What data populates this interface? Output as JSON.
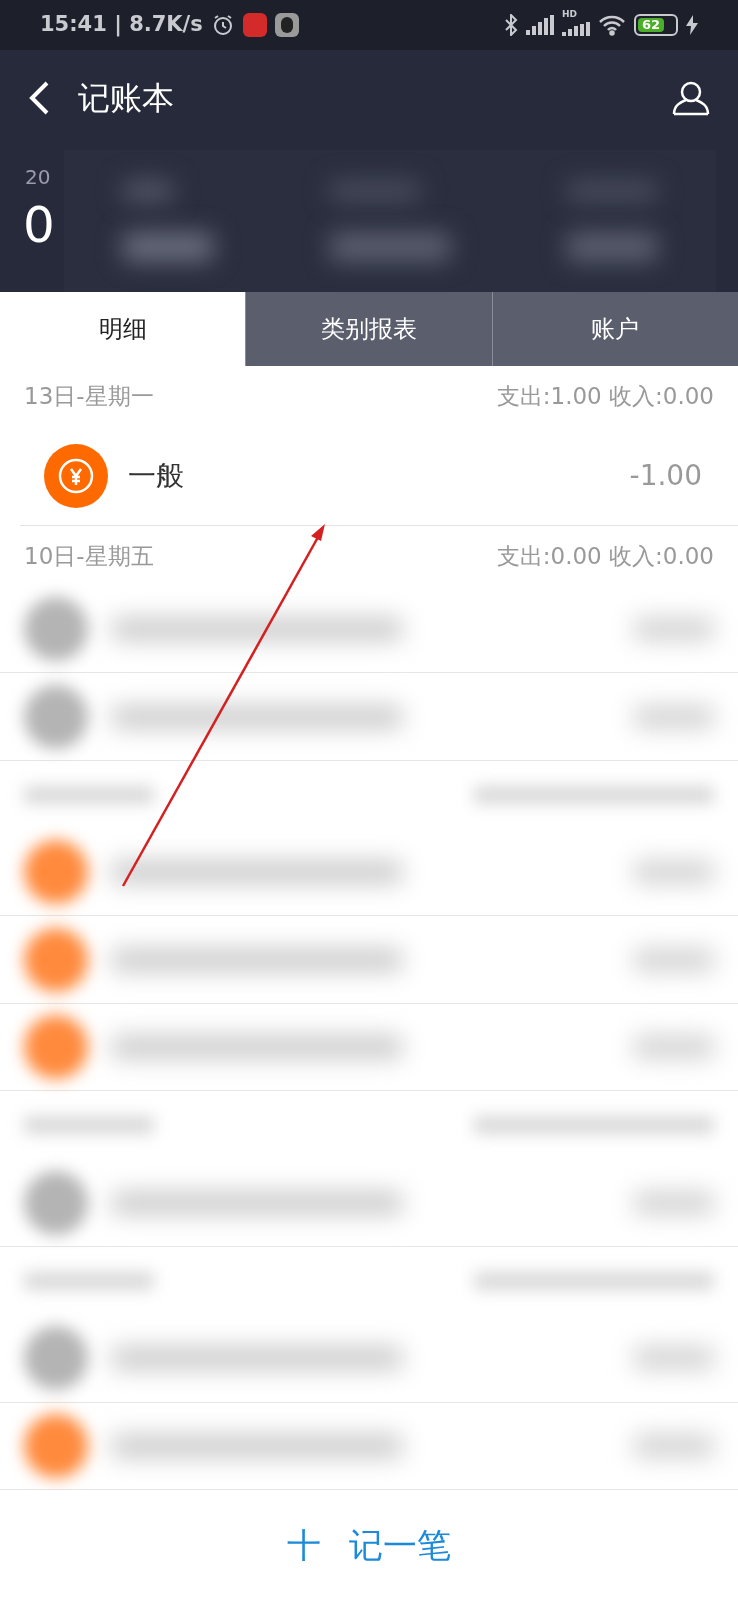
{
  "status_bar": {
    "time": "15:41 | 8.7K/s",
    "network_label": "HD",
    "battery": "62"
  },
  "header": {
    "title": "记账本",
    "year_fragment": "20",
    "amount_fragment": "0"
  },
  "tabs": [
    {
      "label": "明细",
      "selected": true
    },
    {
      "label": "类别报表",
      "selected": false
    },
    {
      "label": "账户",
      "selected": false
    }
  ],
  "days": [
    {
      "date": "13日-星期一",
      "summary": "支出:1.00 收入:0.00",
      "entries": [
        {
          "name": "一般",
          "amount": "-1.00",
          "color": "#ff6a00"
        }
      ]
    },
    {
      "date": "10日-星期五",
      "summary": "支出:0.00 收入:0.00"
    }
  ],
  "redacted_rows": [
    {
      "kind": "entry",
      "color": "#b4b4b4"
    },
    {
      "kind": "entry",
      "color": "#b4b4b4"
    },
    {
      "kind": "header"
    },
    {
      "kind": "entry",
      "color": "#ff8a3d"
    },
    {
      "kind": "entry",
      "color": "#ff8a3d"
    },
    {
      "kind": "entry",
      "color": "#ff8a3d"
    },
    {
      "kind": "header"
    },
    {
      "kind": "entry",
      "color": "#b4b4b4"
    },
    {
      "kind": "header"
    },
    {
      "kind": "entry",
      "color": "#b4b4b4"
    },
    {
      "kind": "entry",
      "color": "#ff8a3d"
    }
  ],
  "add_button": {
    "icon": "十",
    "label": "记一笔"
  }
}
